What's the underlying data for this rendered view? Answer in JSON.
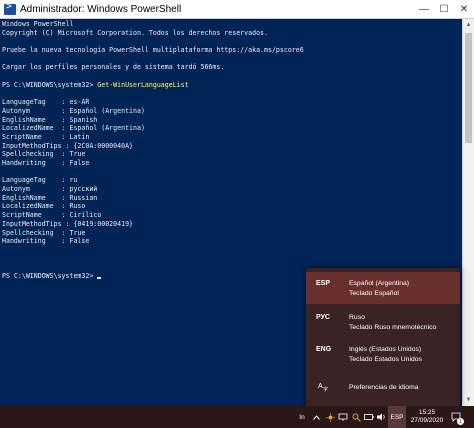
{
  "window": {
    "title": "Administrador: Windows PowerShell",
    "minimize_glyph": "—",
    "maximize_glyph": "☐",
    "close_glyph": "✕"
  },
  "console": {
    "lines": [
      "Windows PowerShell",
      "Copyright (C) Microsoft Corporation. Todos los derechos reservados.",
      "",
      "Pruebe la nueva tecnología PowerShell multiplataforma https://aka.ms/pscore6",
      "",
      "Cargar los perfiles personales y de sistema tardó 566ms.",
      "",
      "",
      "",
      "LanguageTag    : es-AR",
      "Autonym        : Español (Argentina)",
      "EnglishName    : Spanish",
      "LocalizedName  : Español (Argentina)",
      "ScriptName     : Latín",
      "InputMethodTips : {2C0A:0000040A}",
      "Spellchecking  : True",
      "Handwriting    : False",
      "",
      "LanguageTag    : ru",
      "Autonym        : русский",
      "EnglishName    : Russian",
      "LocalizedName  : Ruso",
      "ScriptName     : Cirílico",
      "InputMethodTips : {0419:00020419}",
      "Spellchecking  : True",
      "Handwriting    : False",
      "",
      "",
      "",
      "PS C:\\WINDOWS\\system32> "
    ],
    "prompt_line_index": 7,
    "prompt": "PS C:\\WINDOWS\\system32> ",
    "command": "Get-WinUserLanguageList"
  },
  "language_flyout": {
    "items": [
      {
        "code": "ESP",
        "name": "Español (Argentina)",
        "keyboard": "Teclado Español",
        "selected": true
      },
      {
        "code": "РУС",
        "name": "Ruso",
        "keyboard": "Teclado Ruso mnemotécnico",
        "selected": false
      },
      {
        "code": "ENG",
        "name": "Inglés (Estados Unidos)",
        "keyboard": "Teclado Estados Unidos",
        "selected": false
      }
    ],
    "preferences_label": "Preferencias de idioma",
    "preferences_icon": "language-settings-icon"
  },
  "taskbar": {
    "tray_in": "In",
    "input_indicator": "ESP",
    "time": "15:25",
    "date": "27/09/2020",
    "notification_count": "1"
  },
  "colors": {
    "console_bg": "#012456",
    "console_fg": "#eeedf0",
    "command_fg": "#ffff55",
    "flyout_bg": "#3c2323",
    "flyout_selected": "#6a3030",
    "taskbar_bg": "#2a1716"
  }
}
